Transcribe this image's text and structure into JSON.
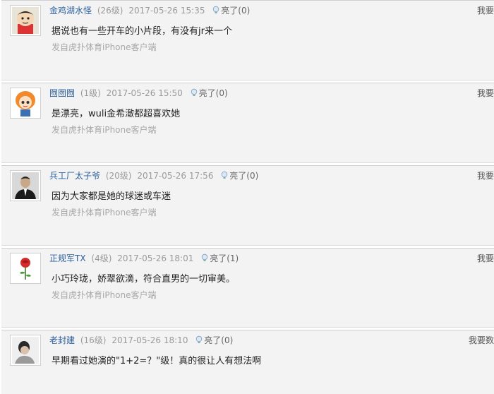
{
  "posts": [
    {
      "username": "金鸡湖水怪",
      "level": "(26级)",
      "time": "2017-05-26 15:35",
      "light_label": "亮了(0)",
      "content": "据说也有一些开车的小片段，有没有jr来一个",
      "source": "发自虎扑体育iPhone客户端",
      "report_label": "我要"
    },
    {
      "username": "囫囫囫",
      "level": "(1级)",
      "time": "2017-05-26 15:50",
      "light_label": "亮了(0)",
      "content": "是漂亮，wuli金希澈都超喜欢她",
      "source": "发自虎扑体育iPhone客户端",
      "report_label": "我要"
    },
    {
      "username": "兵工厂太子爷",
      "level": "(20级)",
      "time": "2017-05-26 17:56",
      "light_label": "亮了(0)",
      "content": "因为大家都是她的球迷或车迷",
      "source": "发自虎扑体育iPhone客户端",
      "report_label": "我要"
    },
    {
      "username": "正规军TX",
      "level": "(4级)",
      "time": "2017-05-26 18:01",
      "light_label": "亮了(1)",
      "content": "小巧玲珑，娇翠欲滴，符合直男的一切审美。",
      "source": "发自虎扑体育iPhone客户端",
      "report_label": "我要"
    },
    {
      "username": "老封建",
      "level": "(16级)",
      "time": "2017-05-26 18:10",
      "light_label": "亮了(0)",
      "content": "早期看过她演的\"1+2=？\"级！真的很让人有想法啊",
      "report_label": "我要数"
    }
  ]
}
